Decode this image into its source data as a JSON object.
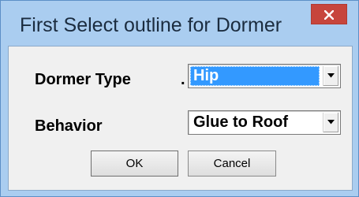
{
  "window": {
    "title": "First Select outline for Dormer",
    "close_glyph": "×"
  },
  "form": {
    "dormer_type_label": "Dormer Type",
    "dormer_type_value": "Hip",
    "dot": ".",
    "behavior_label": "Behavior",
    "behavior_value": "Glue to Roof"
  },
  "buttons": {
    "ok_label": "OK",
    "cancel_label": "Cancel"
  },
  "colors": {
    "title_bar": "#aacdf0",
    "close_button": "#c7453c",
    "selection": "#3399ff",
    "dialog_body": "#f0f0f0"
  }
}
